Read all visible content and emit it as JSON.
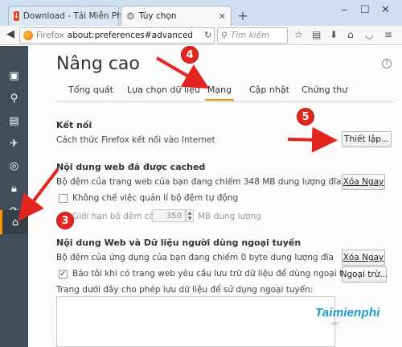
{
  "browser": {
    "tabs": [
      {
        "title": "Download - Tải Miễn Phí ..."
      },
      {
        "title": "Tùy chọn"
      }
    ],
    "identity_label": "Firefox",
    "url": "about:preferences#advanced",
    "search_placeholder": "Tìm kiếm"
  },
  "page": {
    "title": "Nâng cao",
    "tabs": [
      "Tổng quát",
      "Lựa chọn dữ liệu",
      "Mạng",
      "Cập nhật",
      "Chứng thư"
    ],
    "selected_tab": "Mạng"
  },
  "connection": {
    "heading": "Kết nối",
    "desc": "Cách thức Firefox kết nối vào Internet",
    "button": "Thiết lập..."
  },
  "cache": {
    "heading": "Nội dung web đã được cached",
    "usage": "Bộ đệm của trang web của bạn đang chiếm 348 MB dung lượng đĩa",
    "clear_button": "Xóa Ngay",
    "override_label": "Không chế việc quản lí bộ đệm tự động",
    "limit_prefix": "Giới hạn bộ đệm còn",
    "limit_value": "350",
    "limit_suffix": "MB dung lượng"
  },
  "offline": {
    "heading": "Nội dung Web và Dữ liệu người dùng ngoại tuyến",
    "usage": "Bộ đệm của ứng dụng của bạn đang chiếm 0 byte dung lượng đĩa",
    "clear_button": "Xóa Ngay",
    "notify_label": "Báo tôi khi có trang web yêu cầu lưu trữ dữ liệu để dùng ngoại tuyến",
    "exceptions_button": "Ngoại trừ...",
    "list_label": "Trang dưới đây cho phép lưu dữ liệu để sử dụng ngoại tuyến:"
  },
  "annotations": {
    "badge_3": "3",
    "badge_4": "4",
    "badge_5": "5",
    "color": "#e2251f"
  },
  "watermark": {
    "brand": "Taimienphi",
    "sub": ".vn"
  },
  "colors": {
    "sidebar": "#424f5a",
    "accent": "#ff9500"
  },
  "icons": {
    "sidebar": [
      "general-icon",
      "search-icon",
      "content-icon",
      "applications-icon",
      "privacy-icon",
      "security-icon",
      "sync-icon",
      "advanced-icon"
    ]
  }
}
